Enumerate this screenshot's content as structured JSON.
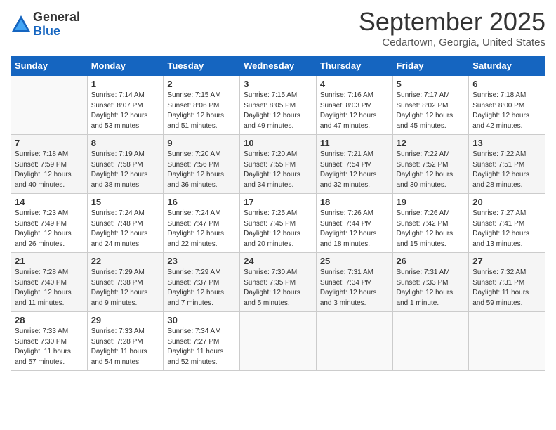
{
  "header": {
    "logo_general": "General",
    "logo_blue": "Blue",
    "month_title": "September 2025",
    "location": "Cedartown, Georgia, United States"
  },
  "weekdays": [
    "Sunday",
    "Monday",
    "Tuesday",
    "Wednesday",
    "Thursday",
    "Friday",
    "Saturday"
  ],
  "weeks": [
    [
      {
        "day": "",
        "sunrise": "",
        "sunset": "",
        "daylight": ""
      },
      {
        "day": "1",
        "sunrise": "Sunrise: 7:14 AM",
        "sunset": "Sunset: 8:07 PM",
        "daylight": "Daylight: 12 hours and 53 minutes."
      },
      {
        "day": "2",
        "sunrise": "Sunrise: 7:15 AM",
        "sunset": "Sunset: 8:06 PM",
        "daylight": "Daylight: 12 hours and 51 minutes."
      },
      {
        "day": "3",
        "sunrise": "Sunrise: 7:15 AM",
        "sunset": "Sunset: 8:05 PM",
        "daylight": "Daylight: 12 hours and 49 minutes."
      },
      {
        "day": "4",
        "sunrise": "Sunrise: 7:16 AM",
        "sunset": "Sunset: 8:03 PM",
        "daylight": "Daylight: 12 hours and 47 minutes."
      },
      {
        "day": "5",
        "sunrise": "Sunrise: 7:17 AM",
        "sunset": "Sunset: 8:02 PM",
        "daylight": "Daylight: 12 hours and 45 minutes."
      },
      {
        "day": "6",
        "sunrise": "Sunrise: 7:18 AM",
        "sunset": "Sunset: 8:00 PM",
        "daylight": "Daylight: 12 hours and 42 minutes."
      }
    ],
    [
      {
        "day": "7",
        "sunrise": "Sunrise: 7:18 AM",
        "sunset": "Sunset: 7:59 PM",
        "daylight": "Daylight: 12 hours and 40 minutes."
      },
      {
        "day": "8",
        "sunrise": "Sunrise: 7:19 AM",
        "sunset": "Sunset: 7:58 PM",
        "daylight": "Daylight: 12 hours and 38 minutes."
      },
      {
        "day": "9",
        "sunrise": "Sunrise: 7:20 AM",
        "sunset": "Sunset: 7:56 PM",
        "daylight": "Daylight: 12 hours and 36 minutes."
      },
      {
        "day": "10",
        "sunrise": "Sunrise: 7:20 AM",
        "sunset": "Sunset: 7:55 PM",
        "daylight": "Daylight: 12 hours and 34 minutes."
      },
      {
        "day": "11",
        "sunrise": "Sunrise: 7:21 AM",
        "sunset": "Sunset: 7:54 PM",
        "daylight": "Daylight: 12 hours and 32 minutes."
      },
      {
        "day": "12",
        "sunrise": "Sunrise: 7:22 AM",
        "sunset": "Sunset: 7:52 PM",
        "daylight": "Daylight: 12 hours and 30 minutes."
      },
      {
        "day": "13",
        "sunrise": "Sunrise: 7:22 AM",
        "sunset": "Sunset: 7:51 PM",
        "daylight": "Daylight: 12 hours and 28 minutes."
      }
    ],
    [
      {
        "day": "14",
        "sunrise": "Sunrise: 7:23 AM",
        "sunset": "Sunset: 7:49 PM",
        "daylight": "Daylight: 12 hours and 26 minutes."
      },
      {
        "day": "15",
        "sunrise": "Sunrise: 7:24 AM",
        "sunset": "Sunset: 7:48 PM",
        "daylight": "Daylight: 12 hours and 24 minutes."
      },
      {
        "day": "16",
        "sunrise": "Sunrise: 7:24 AM",
        "sunset": "Sunset: 7:47 PM",
        "daylight": "Daylight: 12 hours and 22 minutes."
      },
      {
        "day": "17",
        "sunrise": "Sunrise: 7:25 AM",
        "sunset": "Sunset: 7:45 PM",
        "daylight": "Daylight: 12 hours and 20 minutes."
      },
      {
        "day": "18",
        "sunrise": "Sunrise: 7:26 AM",
        "sunset": "Sunset: 7:44 PM",
        "daylight": "Daylight: 12 hours and 18 minutes."
      },
      {
        "day": "19",
        "sunrise": "Sunrise: 7:26 AM",
        "sunset": "Sunset: 7:42 PM",
        "daylight": "Daylight: 12 hours and 15 minutes."
      },
      {
        "day": "20",
        "sunrise": "Sunrise: 7:27 AM",
        "sunset": "Sunset: 7:41 PM",
        "daylight": "Daylight: 12 hours and 13 minutes."
      }
    ],
    [
      {
        "day": "21",
        "sunrise": "Sunrise: 7:28 AM",
        "sunset": "Sunset: 7:40 PM",
        "daylight": "Daylight: 12 hours and 11 minutes."
      },
      {
        "day": "22",
        "sunrise": "Sunrise: 7:29 AM",
        "sunset": "Sunset: 7:38 PM",
        "daylight": "Daylight: 12 hours and 9 minutes."
      },
      {
        "day": "23",
        "sunrise": "Sunrise: 7:29 AM",
        "sunset": "Sunset: 7:37 PM",
        "daylight": "Daylight: 12 hours and 7 minutes."
      },
      {
        "day": "24",
        "sunrise": "Sunrise: 7:30 AM",
        "sunset": "Sunset: 7:35 PM",
        "daylight": "Daylight: 12 hours and 5 minutes."
      },
      {
        "day": "25",
        "sunrise": "Sunrise: 7:31 AM",
        "sunset": "Sunset: 7:34 PM",
        "daylight": "Daylight: 12 hours and 3 minutes."
      },
      {
        "day": "26",
        "sunrise": "Sunrise: 7:31 AM",
        "sunset": "Sunset: 7:33 PM",
        "daylight": "Daylight: 12 hours and 1 minute."
      },
      {
        "day": "27",
        "sunrise": "Sunrise: 7:32 AM",
        "sunset": "Sunset: 7:31 PM",
        "daylight": "Daylight: 11 hours and 59 minutes."
      }
    ],
    [
      {
        "day": "28",
        "sunrise": "Sunrise: 7:33 AM",
        "sunset": "Sunset: 7:30 PM",
        "daylight": "Daylight: 11 hours and 57 minutes."
      },
      {
        "day": "29",
        "sunrise": "Sunrise: 7:33 AM",
        "sunset": "Sunset: 7:28 PM",
        "daylight": "Daylight: 11 hours and 54 minutes."
      },
      {
        "day": "30",
        "sunrise": "Sunrise: 7:34 AM",
        "sunset": "Sunset: 7:27 PM",
        "daylight": "Daylight: 11 hours and 52 minutes."
      },
      {
        "day": "",
        "sunrise": "",
        "sunset": "",
        "daylight": ""
      },
      {
        "day": "",
        "sunrise": "",
        "sunset": "",
        "daylight": ""
      },
      {
        "day": "",
        "sunrise": "",
        "sunset": "",
        "daylight": ""
      },
      {
        "day": "",
        "sunrise": "",
        "sunset": "",
        "daylight": ""
      }
    ]
  ]
}
